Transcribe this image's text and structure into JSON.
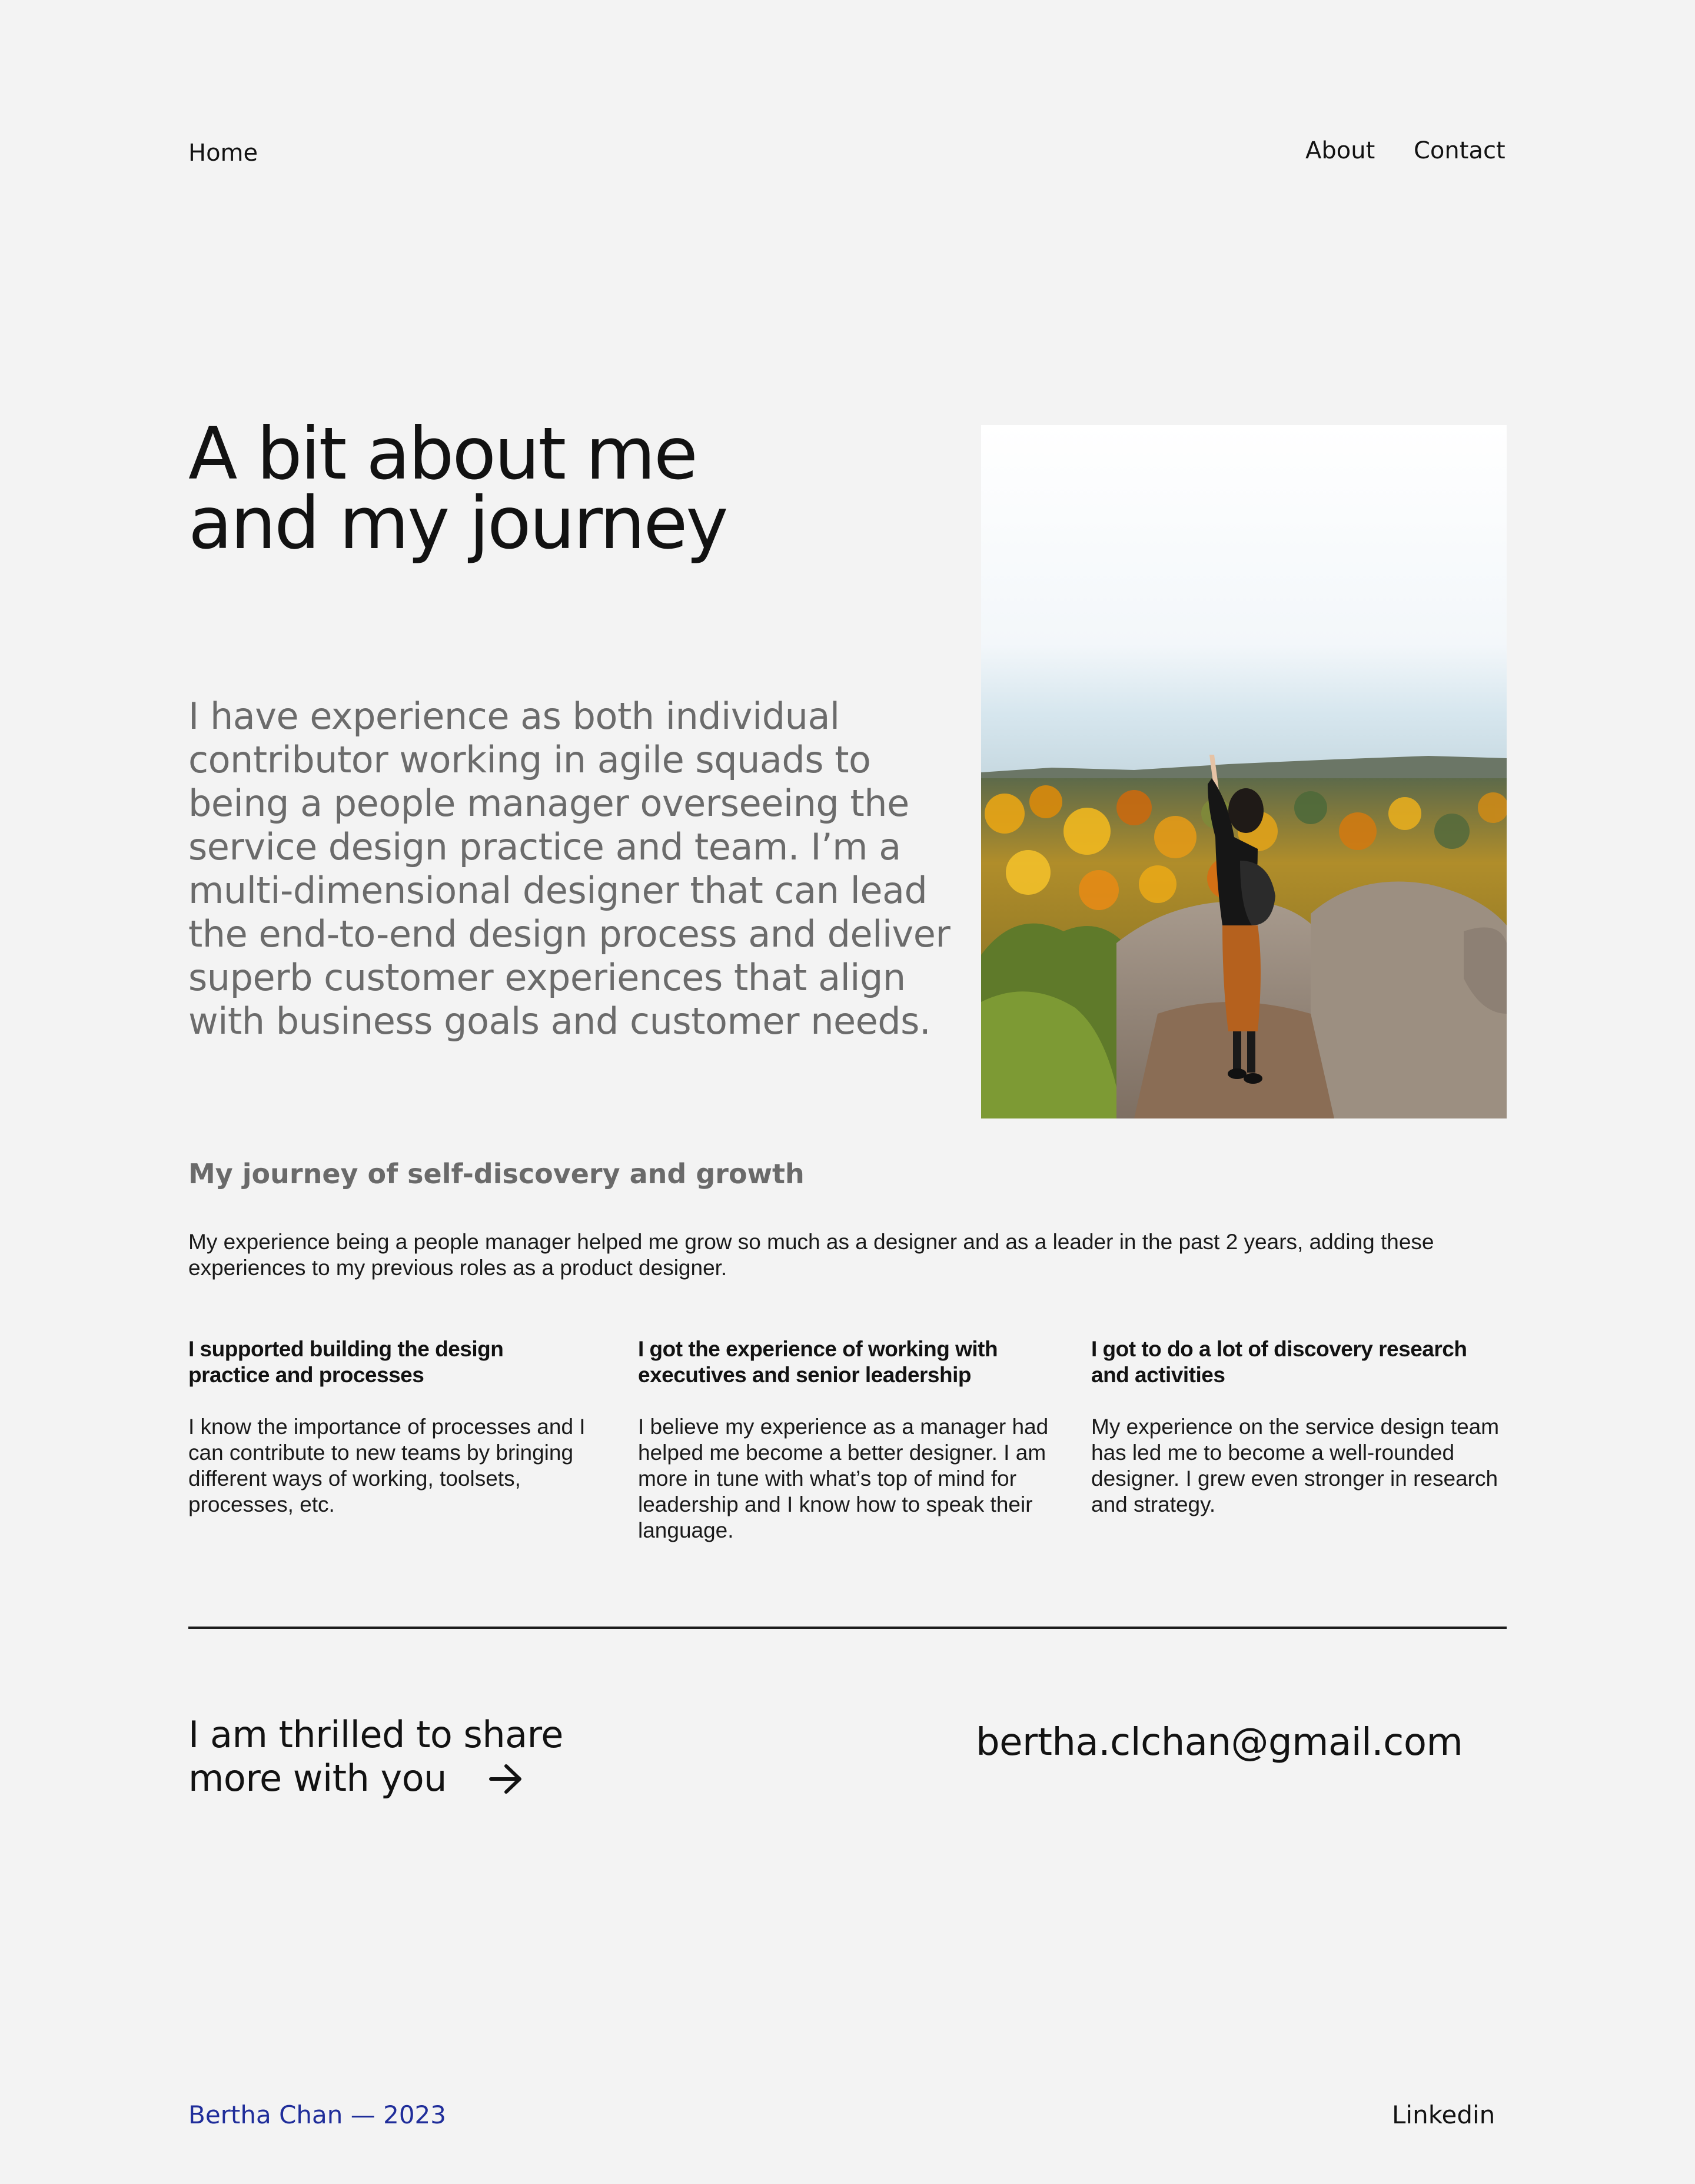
{
  "nav": {
    "home": "Home",
    "about": "About",
    "contact": "Contact"
  },
  "hero": {
    "title_line1": "A bit about me",
    "title_line2": "and my journey",
    "intro": "I have experience as both individual contributor working in agile squads to being a people manager overseeing the service design practice and team. I’m a multi-dimensional designer that can lead the end-to-end design process and deliver superb customer experiences that align with business goals and customer needs."
  },
  "journey": {
    "heading": "My journey of self-discovery and growth",
    "intro": "My experience being a people manager helped me grow so much as a designer and as a leader in the past 2 years, adding these experiences to my previous roles as a product designer.",
    "columns": [
      {
        "title": "I supported building the design practice and processes",
        "body": "I know the importance of processes and I can contribute to new teams by bringing different ways of working, toolsets, processes, etc."
      },
      {
        "title": "I got the experience of working with executives and senior leadership",
        "body": "I believe my experience as a manager had helped me become a better designer. I am more in tune with what’s top of mind for leadership and I know how to speak their language."
      },
      {
        "title": "I got to do a lot of discovery research and activities",
        "body": "My experience on the service design team has led me to become a well-rounded designer. I grew even stronger in research and strategy."
      }
    ]
  },
  "cta": {
    "line1": "I am thrilled to share",
    "line2": "more with you",
    "arrow_icon": "arrow-right-icon",
    "email": "bertha.clchan@gmail.com"
  },
  "footer": {
    "name": "Bertha Chan — 2023",
    "linkedin": "Linkedin"
  },
  "colors": {
    "background": "#f3f3f3",
    "text": "#121212",
    "muted": "#6b6b6b",
    "footer_name": "#1f2d9a"
  }
}
